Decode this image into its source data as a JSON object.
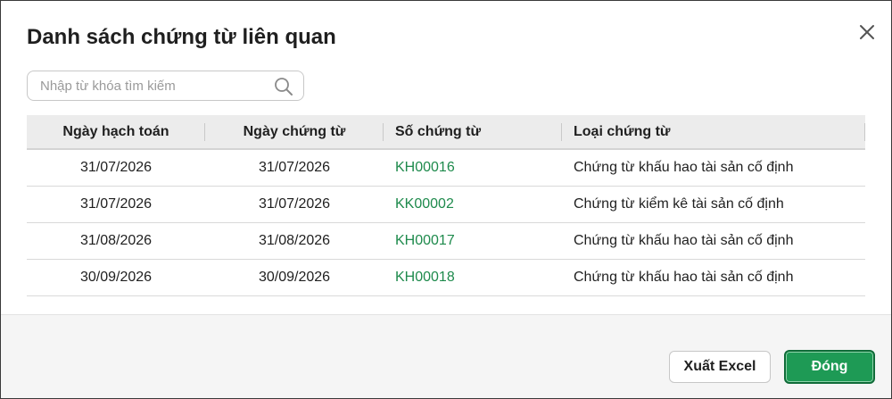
{
  "dialog": {
    "title": "Danh sách chứng từ liên quan"
  },
  "search": {
    "placeholder": "Nhập từ khóa tìm kiếm",
    "value": ""
  },
  "table": {
    "headers": [
      "Ngày hạch toán",
      "Ngày chứng từ",
      "Số chứng từ",
      "Loại chứng từ"
    ],
    "rows": [
      {
        "posting_date": "31/07/2026",
        "doc_date": "31/07/2026",
        "doc_no": "KH00016",
        "doc_type": "Chứng từ khấu hao tài sản cố định"
      },
      {
        "posting_date": "31/07/2026",
        "doc_date": "31/07/2026",
        "doc_no": "KK00002",
        "doc_type": "Chứng từ kiểm kê tài sản cố định"
      },
      {
        "posting_date": "31/08/2026",
        "doc_date": "31/08/2026",
        "doc_no": "KH00017",
        "doc_type": "Chứng từ khấu hao tài sản cố định"
      },
      {
        "posting_date": "30/09/2026",
        "doc_date": "30/09/2026",
        "doc_no": "KH00018",
        "doc_type": "Chứng từ khấu hao tài sản cố định"
      }
    ]
  },
  "footer": {
    "export_label": "Xuất Excel",
    "close_label": "Đóng"
  },
  "colors": {
    "accent": "#1e9a55",
    "link": "#1e8a4c"
  }
}
